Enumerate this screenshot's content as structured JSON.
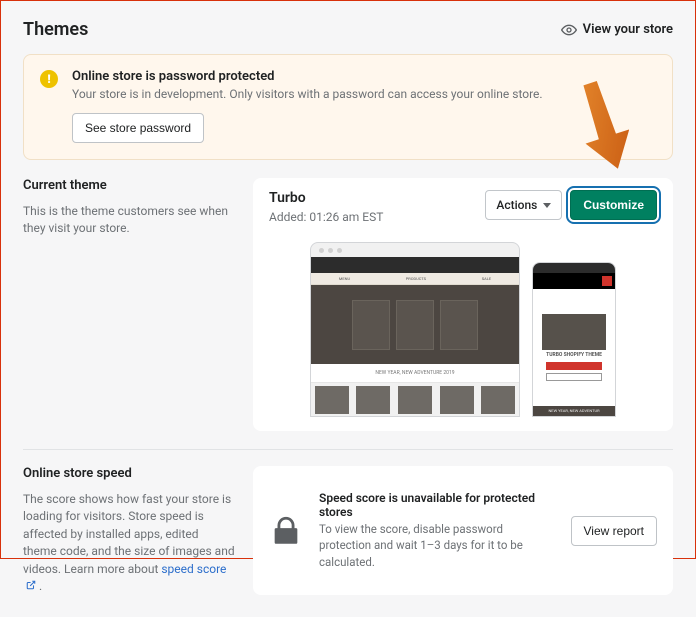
{
  "header": {
    "title": "Themes",
    "view_store_label": "View your store"
  },
  "banner": {
    "title": "Online store is password protected",
    "subtitle": "Your store is in development. Only visitors with a password can access your online store.",
    "button_label": "See store password"
  },
  "current_theme": {
    "section_title": "Current theme",
    "section_desc": "This is the theme customers see when they visit your store.",
    "name": "Turbo",
    "added": "Added: 01:26 am EST",
    "actions_label": "Actions",
    "customize_label": "Customize",
    "preview_strip_text": "NEW YEAR, NEW ADVENTURE 2019",
    "mobile_title": "TURBO SHOPIFY THEME",
    "mobile_strip": "NEW YEAR, NEW ADVENTUR"
  },
  "speed": {
    "section_title": "Online store speed",
    "section_desc": "The score shows how fast your store is loading for visitors. Store speed is affected by installed apps, edited theme code, and the size of images and videos. Learn more about ",
    "link_label": "speed score",
    "card_title": "Speed score is unavailable for protected stores",
    "card_sub": "To view the score, disable password protection and wait 1–3 days for it to be calculated.",
    "button_label": "View report"
  }
}
